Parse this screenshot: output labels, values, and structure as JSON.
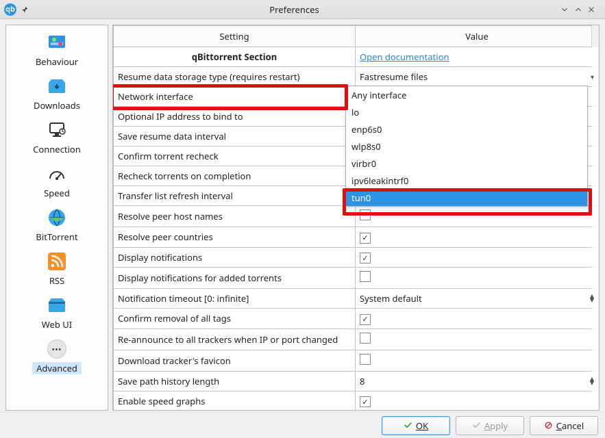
{
  "window": {
    "title": "Preferences"
  },
  "sidebar": {
    "items": [
      {
        "id": "behaviour",
        "label": "Behaviour"
      },
      {
        "id": "downloads",
        "label": "Downloads"
      },
      {
        "id": "connection",
        "label": "Connection"
      },
      {
        "id": "speed",
        "label": "Speed"
      },
      {
        "id": "bittorrent",
        "label": "BitTorrent"
      },
      {
        "id": "rss",
        "label": "RSS"
      },
      {
        "id": "webui",
        "label": "Web UI"
      },
      {
        "id": "advanced",
        "label": "Advanced"
      }
    ],
    "selected": "advanced"
  },
  "columns": {
    "setting": "Setting",
    "value": "Value"
  },
  "section": {
    "title": "qBittorrent Section",
    "doc_label": "Open documentation"
  },
  "rows": {
    "resume_storage": {
      "k": "Resume data storage type (requires restart)",
      "v": "Fastresume files"
    },
    "net_iface": {
      "k": "Network interface"
    },
    "bind_ip": {
      "k": "Optional IP address to bind to"
    },
    "save_interval": {
      "k": "Save resume data interval"
    },
    "confirm_recheck": {
      "k": "Confirm torrent recheck"
    },
    "recheck_on_complete": {
      "k": "Recheck torrents on completion"
    },
    "tl_refresh": {
      "k": "Transfer list refresh interval"
    },
    "resolve_host": {
      "k": "Resolve peer host names",
      "checked": false
    },
    "resolve_country": {
      "k": "Resolve peer countries",
      "checked": true
    },
    "display_notif": {
      "k": "Display notifications",
      "checked": true
    },
    "display_notif_added": {
      "k": "Display notifications for added torrents",
      "checked": false
    },
    "notif_timeout": {
      "k": "Notification timeout [0: infinite]",
      "v": "System default"
    },
    "confirm_tags": {
      "k": "Confirm removal of all tags",
      "checked": true
    },
    "reannounce": {
      "k": "Re-announce to all trackers when IP or port changed",
      "checked": false
    },
    "dl_favicon": {
      "k": "Download tracker's favicon",
      "checked": false
    },
    "save_path_hist": {
      "k": "Save path history length",
      "v": "8"
    },
    "speed_graphs": {
      "k": "Enable speed graphs",
      "checked": true
    }
  },
  "iface_dropdown": {
    "options": [
      "Any interface",
      "lo",
      "enp6s0",
      "wlp8s0",
      "virbr0",
      "ipv6leakintrf0",
      "tun0"
    ],
    "selected": "tun0"
  },
  "buttons": {
    "ok": "OK",
    "apply": "Apply",
    "cancel": "Cancel"
  }
}
